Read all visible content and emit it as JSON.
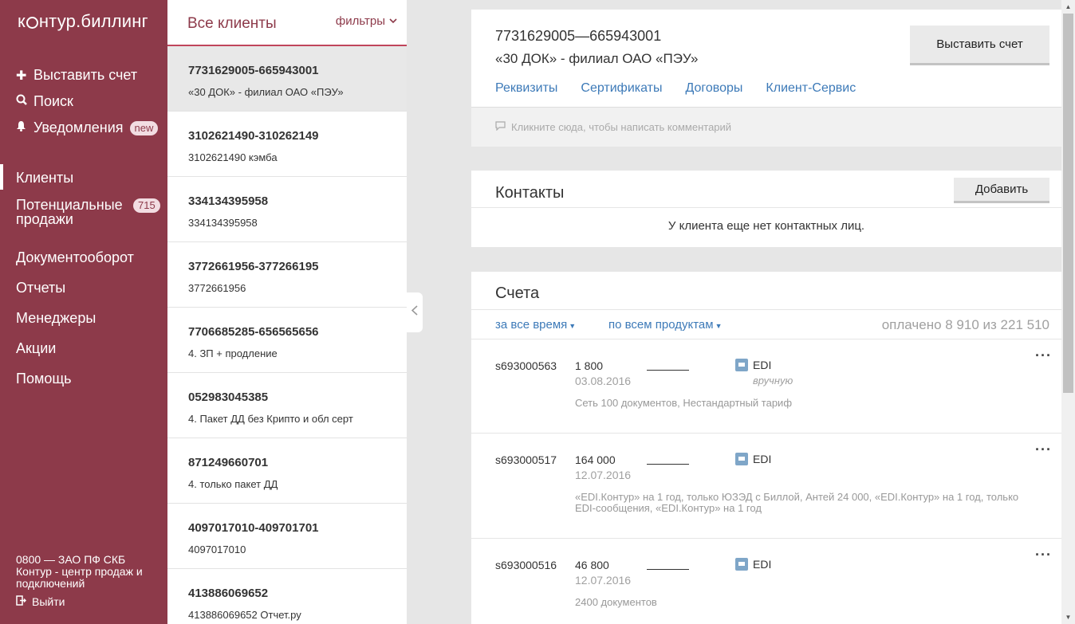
{
  "sidebar": {
    "logo_pre": "к",
    "logo_post": "нтур.биллинг",
    "actions": [
      {
        "icon": "plus-icon",
        "glyph": "✚",
        "label": "Выставить счет"
      },
      {
        "icon": "search-icon",
        "glyph": "🔍",
        "label": "Поиск"
      },
      {
        "icon": "bell-icon",
        "glyph": "🔔",
        "label": "Уведомления",
        "badge": "new"
      }
    ],
    "nav": [
      {
        "label": "Клиенты",
        "active": true
      },
      {
        "label": "Потенциальные продажи",
        "badge": "715"
      },
      {
        "label": "Документооборот"
      },
      {
        "label": "Отчеты"
      },
      {
        "label": "Менеджеры"
      },
      {
        "label": "Акции"
      },
      {
        "label": "Помощь"
      }
    ],
    "footer_line1": "0800 — ЗАО ПФ СКБ",
    "footer_line2": "Контур - центр продаж и подключений",
    "logout": "Выйти"
  },
  "clients": {
    "title": "Все клиенты",
    "filters": "фильтры",
    "items": [
      {
        "inn": "7731629005-665943001",
        "name": "«30 ДОК» - филиал ОАО «ПЭУ»"
      },
      {
        "inn": "3102621490-310262149",
        "name": "3102621490 кэмба"
      },
      {
        "inn": "334134395958",
        "name": "334134395958"
      },
      {
        "inn": "3772661956-377266195",
        "name": "3772661956"
      },
      {
        "inn": "7706685285-656565656",
        "name": "4. ЗП + продление"
      },
      {
        "inn": "052983045385",
        "name": "4. Пакет ДД без Крипто и обл серт"
      },
      {
        "inn": "871249660701",
        "name": "4. только пакет ДД"
      },
      {
        "inn": "4097017010-409701701",
        "name": "4097017010"
      },
      {
        "inn": "413886069652",
        "name": "413886069652 Отчет.ру"
      }
    ]
  },
  "client_card": {
    "id": "7731629005—665943001",
    "name": "«30 ДОК» - филиал ОАО «ПЭУ»",
    "tabs": [
      "Реквизиты",
      "Сертификаты",
      "Договоры",
      "Клиент-Сервис"
    ],
    "invoice_button": "Выставить счет",
    "comment_placeholder": "Кликните сюда, чтобы написать комментарий"
  },
  "contacts": {
    "title": "Контакты",
    "add_button": "Добавить",
    "empty_text": "У клиента еще нет контактных лиц."
  },
  "bills": {
    "title": "Счета",
    "filter_period": "за все время",
    "filter_products": "по всем продуктам",
    "paid_summary": "оплачено 8 910 из 221 510",
    "items": [
      {
        "number": "s693000563",
        "amount": "1 800",
        "date": "03.08.2016",
        "signature": "________",
        "product": "EDI",
        "mode": "вручную",
        "desc": "Сеть 100 документов, Нестандартный тариф"
      },
      {
        "number": "s693000517",
        "amount": "164 000",
        "date": "12.07.2016",
        "signature": "________",
        "product": "EDI",
        "mode": "",
        "desc": "«EDI.Контур» на 1 год, только ЮЗЭД с Биллой, Антей 24 000, «EDI.Контур» на 1 год, только EDI-сообщения, «EDI.Контур» на 1 год"
      },
      {
        "number": "s693000516",
        "amount": "46 800",
        "date": "12.07.2016",
        "signature": "________",
        "product": "EDI",
        "mode": "",
        "desc": "2400 документов"
      }
    ]
  }
}
